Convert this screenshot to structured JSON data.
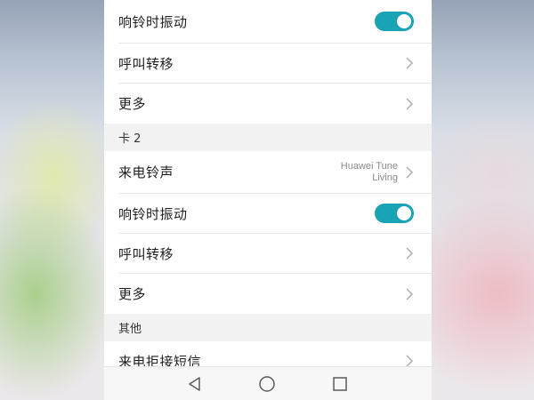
{
  "settings": {
    "card1": {
      "vibrate_label": "响铃时振动",
      "vibrate_on": true,
      "forward_label": "呼叫转移",
      "more_label": "更多"
    },
    "card2": {
      "section_title": "卡 2",
      "ringtone_label": "来电铃声",
      "ringtone_value_line1": "Huawei Tune",
      "ringtone_value_line2": "Living",
      "vibrate_label": "响铃时振动",
      "vibrate_on": true,
      "forward_label": "呼叫转移",
      "more_label": "更多"
    },
    "other": {
      "section_title": "其他",
      "reject_sms_label": "来电拒接短信"
    }
  },
  "colors": {
    "toggle_on": "#1aa3b5",
    "chevron": "#b5b5b5",
    "section_bg": "#f2f2f2"
  },
  "navbar": {
    "icons": [
      "back-icon",
      "home-icon",
      "recents-icon"
    ]
  }
}
